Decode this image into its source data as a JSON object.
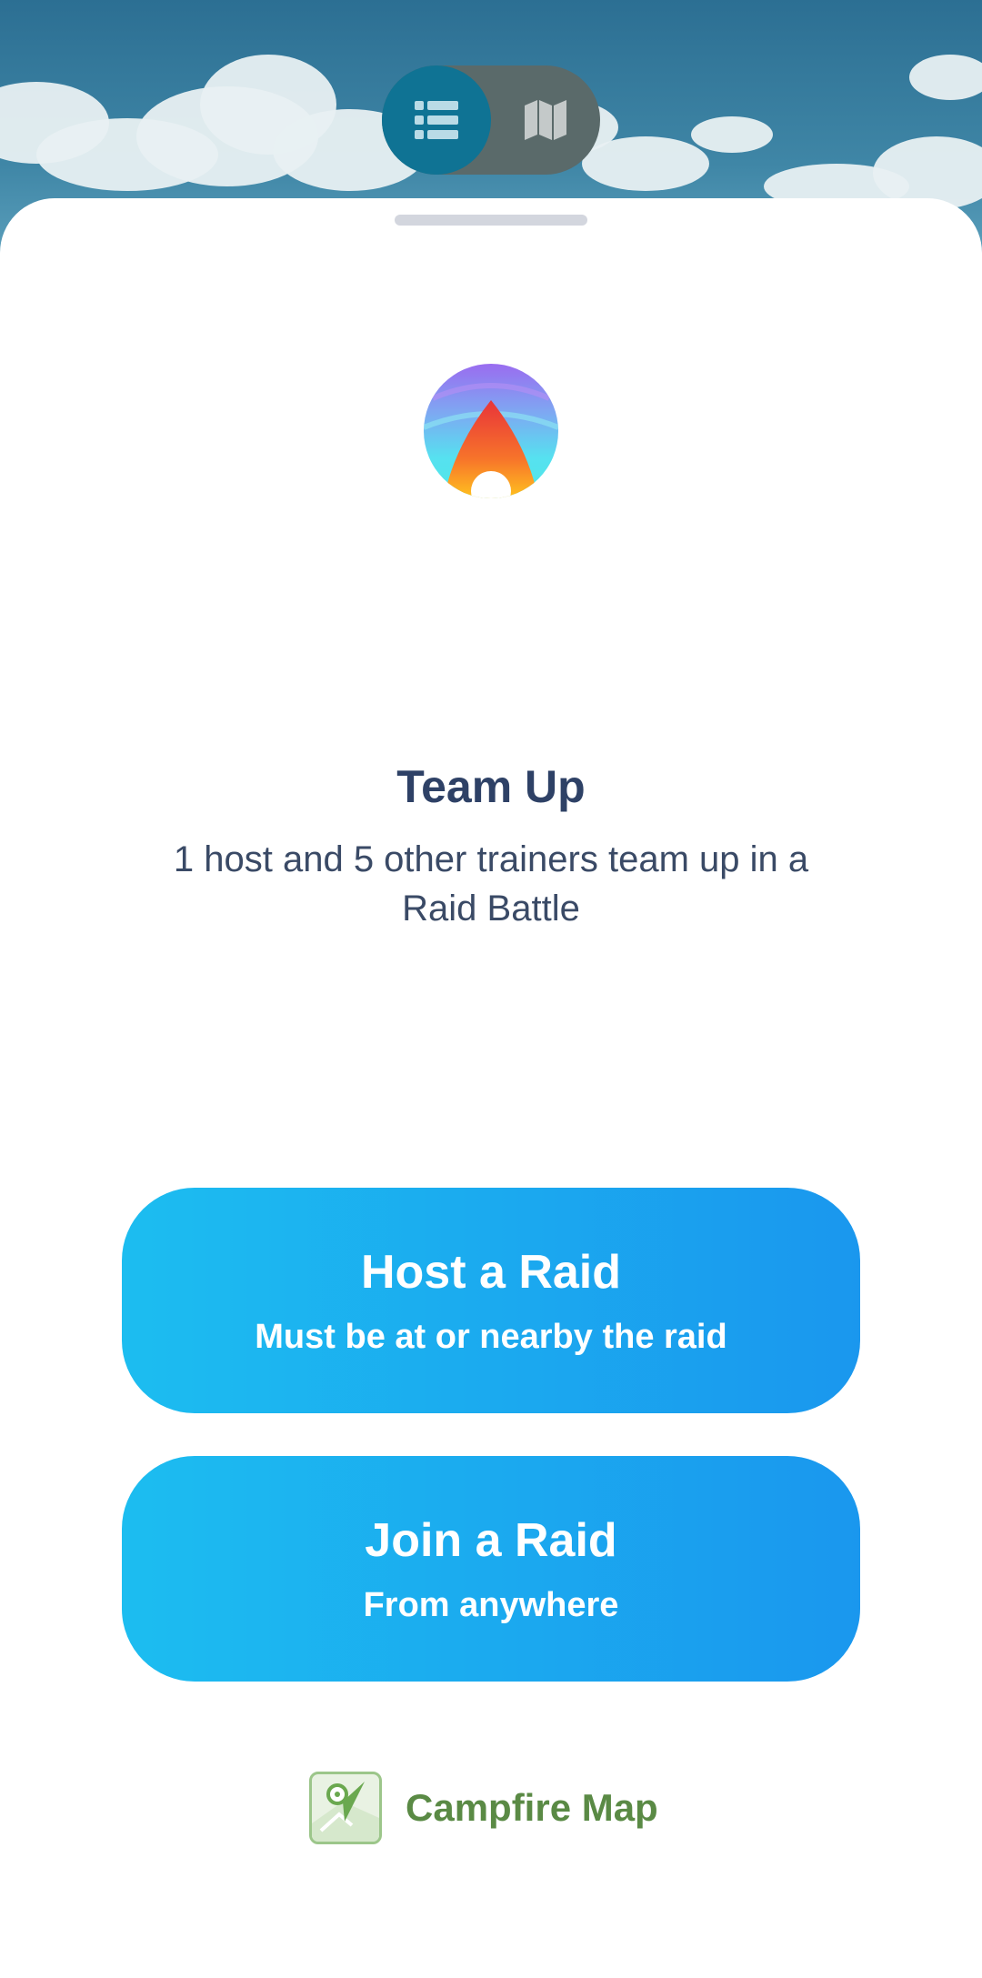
{
  "view_toggle": {
    "list_icon": "list-icon",
    "map_icon": "map-icon",
    "active": "list"
  },
  "main": {
    "logo_icon": "campfire-flame-logo",
    "title": "Team Up",
    "subtitle": "1 host and 5 other trainers team up in a Raid Battle"
  },
  "actions": {
    "host": {
      "title": "Host a Raid",
      "subtitle": "Must be at or nearby the raid"
    },
    "join": {
      "title": "Join a Raid",
      "subtitle": "From anywhere"
    }
  },
  "footer": {
    "campfire_icon": "campfire-map-icon",
    "campfire_label": "Campfire Map"
  },
  "colors": {
    "button_start": "#1cbdf0",
    "button_end": "#1a97ee",
    "title": "#2e4166",
    "campfire_green": "#5a8a45"
  }
}
